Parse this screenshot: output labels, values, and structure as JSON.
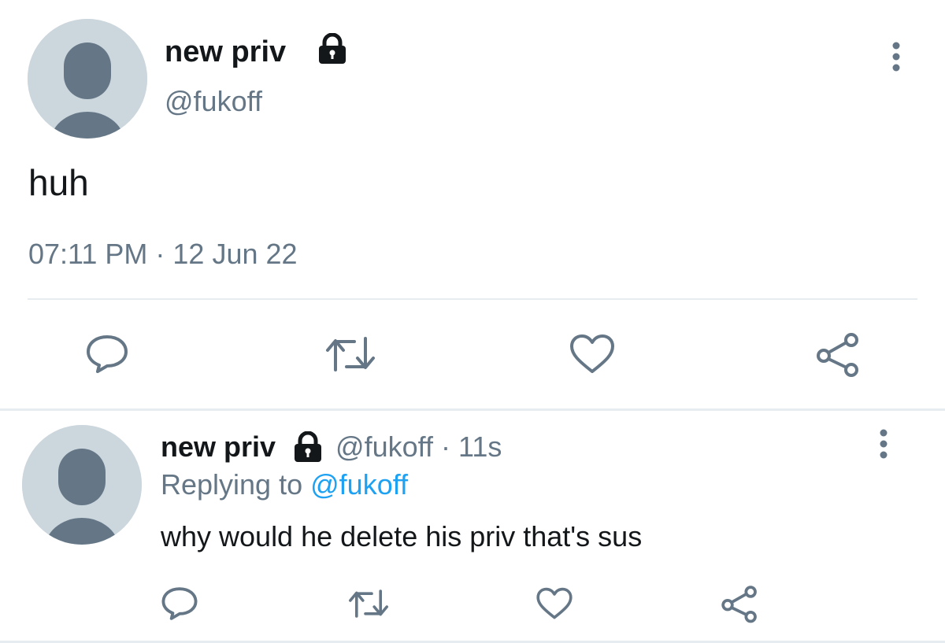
{
  "colors": {
    "text_primary": "#14171a",
    "text_secondary": "#657786",
    "link": "#1da1f2",
    "avatar_bg": "#ccd6dd",
    "avatar_fg": "#657786",
    "divider": "#e6ecf0"
  },
  "main_tweet": {
    "display_name": "new priv",
    "handle": "@fukoff",
    "text": "huh",
    "timestamp": "07:11 PM · 12 Jun 22",
    "icons": [
      "lock-icon",
      "more-vertical-icon",
      "reply-icon",
      "retweet-icon",
      "like-icon",
      "share-icon"
    ]
  },
  "reply_tweet": {
    "display_name": "new priv",
    "handle": "@fukoff",
    "separator": "·",
    "time_ago": "11s",
    "replying_to_label": "Replying to",
    "replying_to_handle": "@fukoff",
    "text": "why would he delete his priv that's sus",
    "icons": [
      "lock-icon",
      "more-vertical-icon",
      "reply-icon",
      "retweet-icon",
      "like-icon",
      "share-icon"
    ]
  }
}
